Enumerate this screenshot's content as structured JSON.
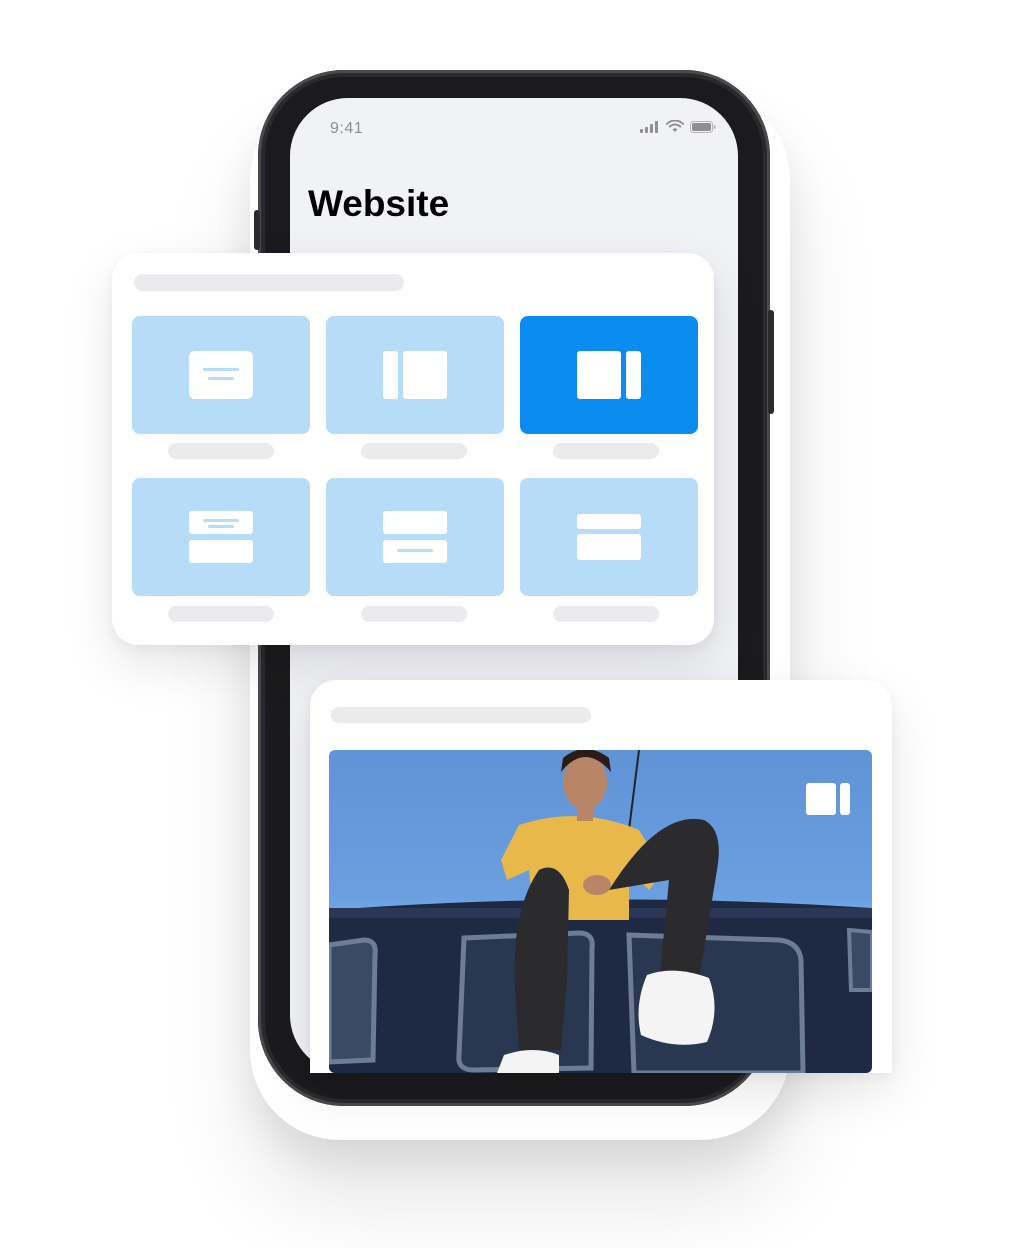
{
  "status_bar": {
    "time": "9:41"
  },
  "page": {
    "title": "Website"
  },
  "layout_picker": {
    "tiles": [
      {
        "icon": "text-card-layout-icon",
        "selected": false
      },
      {
        "icon": "left-sidebar-layout-icon",
        "selected": false
      },
      {
        "icon": "right-sidebar-layout-icon",
        "selected": true
      },
      {
        "icon": "text-top-stack-layout-icon",
        "selected": false
      },
      {
        "icon": "text-bottom-stack-layout-icon",
        "selected": false
      },
      {
        "icon": "two-row-stack-layout-icon",
        "selected": false
      }
    ]
  },
  "preview": {
    "image": "person-sitting-on-van-photo",
    "badge_icon": "right-sidebar-layout-icon"
  },
  "colors": {
    "accent": "#0a8def",
    "tile": "#b7dcf8",
    "placeholder": "#ebebed",
    "screen_bg": "#f1f2f6"
  }
}
